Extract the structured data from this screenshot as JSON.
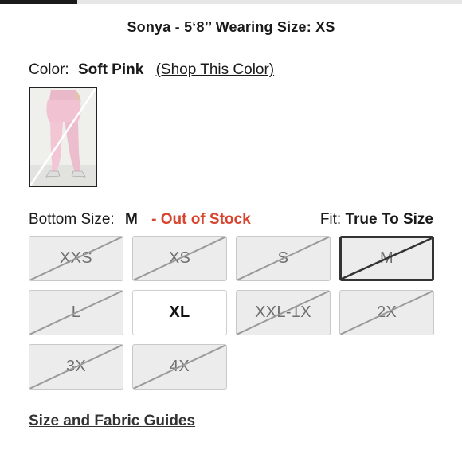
{
  "page": {
    "progress_fraction": 0.167
  },
  "model_info": "Sonya - 5‘8’’ Wearing Size: XS",
  "color": {
    "label": "Color:",
    "name": "Soft Pink",
    "shop_link": "(Shop This Color)",
    "swatch_image": "pink-leggings-photo"
  },
  "sizes": {
    "label": "Bottom Size:",
    "selected": "M",
    "stock_status": "- Out of Stock",
    "fit_label": "Fit:",
    "fit_value": "True To Size",
    "options": [
      {
        "label": "XXS",
        "available": false,
        "selected": false
      },
      {
        "label": "XS",
        "available": false,
        "selected": false
      },
      {
        "label": "S",
        "available": false,
        "selected": false
      },
      {
        "label": "M",
        "available": false,
        "selected": true
      },
      {
        "label": "L",
        "available": false,
        "selected": false
      },
      {
        "label": "XL",
        "available": true,
        "selected": false
      },
      {
        "label": "XXL-1X",
        "available": false,
        "selected": false
      },
      {
        "label": "2X",
        "available": false,
        "selected": false
      },
      {
        "label": "3X",
        "available": false,
        "selected": false
      },
      {
        "label": "4X",
        "available": false,
        "selected": false
      }
    ]
  },
  "guide_link": "Size and Fabric Guides",
  "colors": {
    "out_of_stock": "#d8442e",
    "disabled_bg": "#ececec",
    "strike": "#9a9a9a"
  }
}
